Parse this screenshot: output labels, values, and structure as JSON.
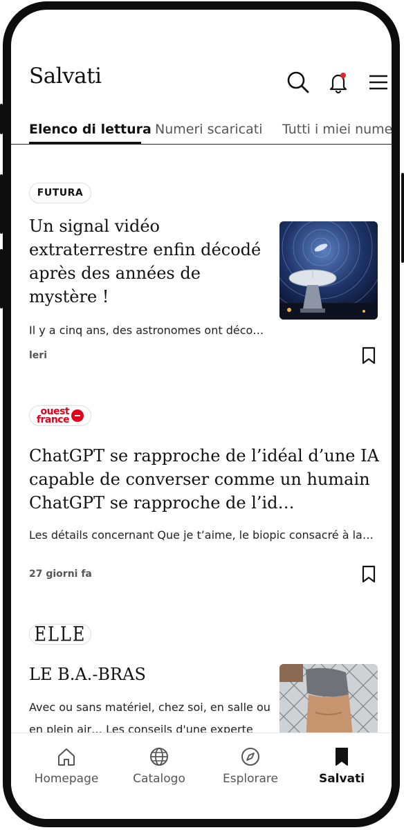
{
  "header": {
    "title": "Salvati"
  },
  "tabs": [
    {
      "label": "Elenco di lettura"
    },
    {
      "label": "Numeri scaricati"
    },
    {
      "label": "Tutti i miei numeri"
    }
  ],
  "articles": [
    {
      "source": "FUTURA",
      "headline": "Un signal vidéo extraterrestre enfin décodé après des années de mystère !",
      "excerpt": "Il y a cinq ans, des astronomes ont déco…",
      "meta": "leri"
    },
    {
      "source": "ouest france",
      "source_line1": "ouest",
      "source_line2": "france",
      "headline": "ChatGPT se rapproche de l’idéal d’une IA capable de converser comme un humain ChatGPT se rapproche de l’id…",
      "excerpt": "Les détails concernant Que je t’aime, le biopic consacré à la…",
      "meta": "27 giorni fa"
    },
    {
      "source": "ELLE",
      "headline": "LE B.A.-BRAS",
      "excerpt_line1": "Avec ou sans matériel, chez soi, en salle ou",
      "excerpt_line2": "en plein air… Les conseils d'une experte"
    }
  ],
  "bottom_nav": [
    {
      "label": "Homepage",
      "icon": "home-icon"
    },
    {
      "label": "Catalogo",
      "icon": "globe-icon"
    },
    {
      "label": "Esplorare",
      "icon": "compass-icon"
    },
    {
      "label": "Salvati",
      "icon": "bookmark-icon",
      "active": true
    }
  ],
  "colors": {
    "accent": "#111111",
    "notification_dot": "#e0242e",
    "ouest_france_red": "#e2001a"
  }
}
